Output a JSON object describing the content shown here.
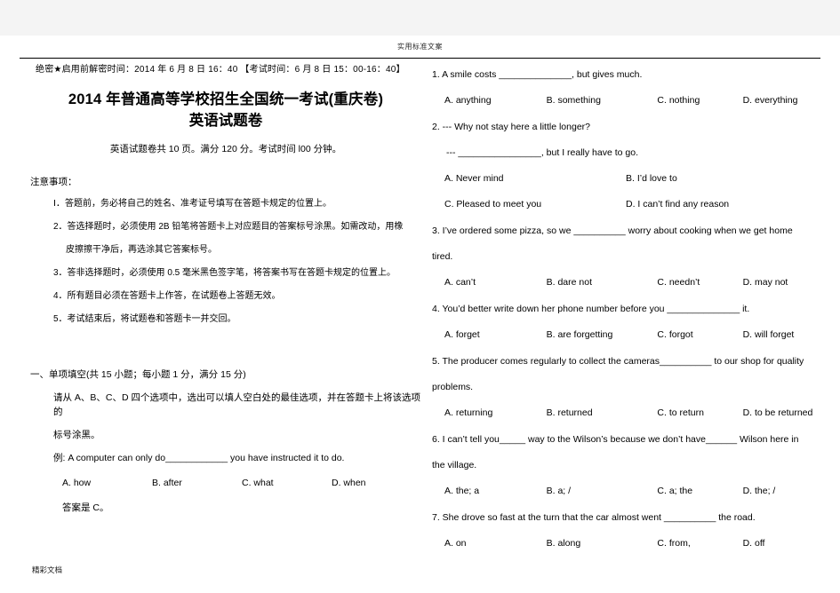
{
  "watermarks": {
    "top": "实用标准文案",
    "bottom": "精彩文档"
  },
  "left_column": {
    "exam_meta": "绝密★启用前解密时间：2014 年 6 月 8 日 16：40   【考试时间：6 月 8 日 15：00-16：40】",
    "title": "2014 年普通高等学校招生全国统一考试(重庆卷)",
    "subtitle": "英语试题卷",
    "note": "英语试题卷共 10 页。满分 120 分。考试时间 l00 分钟。",
    "notice_title": "注意事项：",
    "notice_items": [
      {
        "main": "Ⅰ．答题前，务必将自己的姓名、准考证号填写在答题卡规定的位置上。",
        "cont": ""
      },
      {
        "main": "2．答选择题时，必须使用 2B 铅笔将答题卡上对应题目的答案标号涂黑。如需改动，用橡",
        "cont": "皮擦擦干净后，再选涂其它答案标号。"
      },
      {
        "main": "3．答非选择题时，必须使用 0.5 毫米黑色签字笔，将答案书写在答题卡规定的位置上。",
        "cont": ""
      },
      {
        "main": "4．所有题目必须在答题卡上作答，在试题卷上答题无效。",
        "cont": ""
      },
      {
        "main": "5．考试结束后，将试题卷和答题卡一并交回。",
        "cont": ""
      }
    ],
    "section_head": "一、单项填空(共 15 小题；每小题 1 分，满分 15 分)",
    "section_desc_main": "请从 A、B、C、D 四个选项中，选出可以填人空白处的最佳选项，并在答题卡上将该选项的",
    "section_desc_cont": "标号涂黑。",
    "example_question": "例: A computer can only do____________ you have instructed it to do.",
    "example_options": [
      "A. how",
      "B. after",
      "C. what",
      "D. when"
    ],
    "example_answer": "答案是 C。"
  },
  "questions": [
    {
      "stem": "1. A smile costs ______________, but gives much.",
      "cont": "",
      "subline": "",
      "option_rows": [
        [
          "A. anything",
          "B. something",
          "C. nothing",
          "D. everything"
        ]
      ],
      "layout": "4"
    },
    {
      "stem": "2. --- Why not stay here a little longer?",
      "cont": "",
      "subline": "--- ________________, but I really have to go.",
      "option_rows": [
        [
          "A. Never mind",
          "B. I’d love to"
        ],
        [
          "C. Pleased to meet you",
          "D. I can’t find any reason"
        ]
      ],
      "layout": "2"
    },
    {
      "stem": "3. I’ve ordered some pizza, so we __________ worry about cooking when we get home",
      "cont": "tired.",
      "subline": "",
      "option_rows": [
        [
          "A. can’t",
          "B. dare not",
          "C. needn’t",
          "D. may not"
        ]
      ],
      "layout": "4"
    },
    {
      "stem": "4. You’d better write down her phone number before you ______________ it.",
      "cont": "",
      "subline": "",
      "option_rows": [
        [
          "A. forget",
          "B. are forgetting",
          "C. forgot",
          "D. will forget"
        ]
      ],
      "layout": "4"
    },
    {
      "stem": "5. The producer comes regularly to collect the cameras__________ to our shop for quality",
      "cont": "problems.",
      "subline": "",
      "option_rows": [
        [
          "A. returning",
          "B. returned",
          "C. to return",
          "D. to be returned"
        ]
      ],
      "layout": "4"
    },
    {
      "stem": "6. I can’t tell you_____ way to the Wilson’s because we don’t have______ Wilson here in",
      "cont": "the village.",
      "subline": "",
      "option_rows": [
        [
          "A. the; a",
          "B. a; /",
          "C. a; the",
          "D. the; /"
        ]
      ],
      "layout": "4"
    },
    {
      "stem": "7. She drove so fast at the turn that the car almost went __________ the road.",
      "cont": "",
      "subline": "",
      "option_rows": [
        [
          "A. on",
          "B. along",
          "C. from,",
          "D. off"
        ]
      ],
      "layout": "4"
    }
  ]
}
